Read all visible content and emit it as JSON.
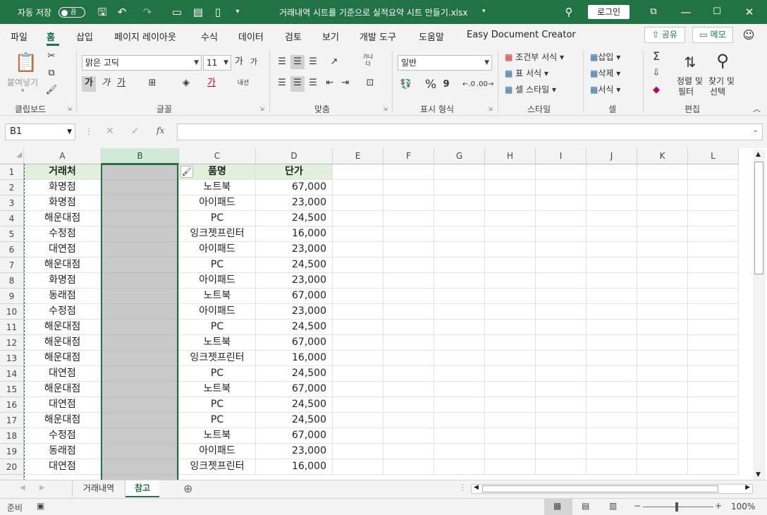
{
  "titlebar": {
    "autosave_label": "자동 저장",
    "toggle_state": "끔",
    "doc_title": "거래내역 시트를 기준으로 실적요약 시트 만들기.xlsx",
    "login_label": "로그인"
  },
  "menu": {
    "tabs": [
      "파일",
      "홈",
      "삽입",
      "페이지 레이아웃",
      "수식",
      "데이터",
      "검토",
      "보기",
      "개발 도구",
      "도움말",
      "Easy Document Creator"
    ],
    "active_tab": "홈",
    "share_label": "공유",
    "memo_label": "메모"
  },
  "ribbon": {
    "paste_label": "붙여넣기",
    "clipboard_label": "클립보드",
    "font_name": "맑은 고딕",
    "font_size": "11",
    "font_grow": "가",
    "font_shrink": "가",
    "bold": "가",
    "italic": "가",
    "underline": "가",
    "font_color_glyph": "가",
    "wrap_glyph": "내선",
    "font_label": "글꼴",
    "orient_glyph": "가나다",
    "align_label": "맞춤",
    "number_format": "일반",
    "percent": "%",
    "comma": "9",
    "number_label": "표시 형식",
    "cond_format": "조건부 서식",
    "table_format": "표 서식",
    "cell_style": "셀 스타일",
    "style_label": "스타일",
    "insert": "삽입",
    "delete": "삭제",
    "format": "서식",
    "cells_label": "셀",
    "sort_filter_1": "정렬 및",
    "sort_filter_2": "필터",
    "find_select_1": "찾기 및",
    "find_select_2": "선택",
    "edit_label": "편집"
  },
  "formula": {
    "name_box": "B1",
    "fx": "fx",
    "value": ""
  },
  "grid": {
    "columns": [
      "A",
      "B",
      "C",
      "D",
      "E",
      "F",
      "G",
      "H",
      "I",
      "J",
      "K",
      "L"
    ],
    "selected_column": "B",
    "header_row": {
      "A": "거래처",
      "B": "",
      "C": "품명",
      "D": "단가"
    },
    "rows": [
      {
        "num": "2",
        "A": "화명점",
        "C": "노트북",
        "D": "67,000"
      },
      {
        "num": "3",
        "A": "화명점",
        "C": "아이패드",
        "D": "23,000"
      },
      {
        "num": "4",
        "A": "해운대점",
        "C": "PC",
        "D": "24,500"
      },
      {
        "num": "5",
        "A": "수정점",
        "C": "잉크젯프린터",
        "D": "16,000"
      },
      {
        "num": "6",
        "A": "대연점",
        "C": "아이패드",
        "D": "23,000"
      },
      {
        "num": "7",
        "A": "해운대점",
        "C": "PC",
        "D": "24,500"
      },
      {
        "num": "8",
        "A": "화명점",
        "C": "아이패드",
        "D": "23,000"
      },
      {
        "num": "9",
        "A": "동래점",
        "C": "노트북",
        "D": "67,000"
      },
      {
        "num": "10",
        "A": "수정점",
        "C": "아이패드",
        "D": "23,000"
      },
      {
        "num": "11",
        "A": "해운대점",
        "C": "PC",
        "D": "24,500"
      },
      {
        "num": "12",
        "A": "해운대점",
        "C": "노트북",
        "D": "67,000"
      },
      {
        "num": "13",
        "A": "해운대점",
        "C": "잉크젯프린터",
        "D": "16,000"
      },
      {
        "num": "14",
        "A": "대연점",
        "C": "PC",
        "D": "24,500"
      },
      {
        "num": "15",
        "A": "해운대점",
        "C": "노트북",
        "D": "67,000"
      },
      {
        "num": "16",
        "A": "대연점",
        "C": "PC",
        "D": "24,500"
      },
      {
        "num": "17",
        "A": "해운대점",
        "C": "PC",
        "D": "24,500"
      },
      {
        "num": "18",
        "A": "수정점",
        "C": "노트북",
        "D": "67,000"
      },
      {
        "num": "19",
        "A": "동래점",
        "C": "아이패드",
        "D": "23,000"
      },
      {
        "num": "20",
        "A": "대연점",
        "C": "잉크젯프린터",
        "D": "16,000"
      }
    ]
  },
  "sheets": {
    "tabs": [
      "거래내역",
      "참고"
    ],
    "active": "참고"
  },
  "status": {
    "ready": "준비",
    "zoom": "100%",
    "zoom_minus": "−",
    "zoom_plus": "+",
    "zoom_level_percent": 100
  },
  "colors": {
    "accent": "#217346",
    "header_fill": "#e2efda",
    "selected_fill": "#c9c9c9"
  },
  "icons": [
    "save-icon",
    "undo-icon",
    "redo-icon",
    "search-icon",
    "restore-icon",
    "minimize-icon",
    "maximize-icon",
    "close-icon",
    "paste-icon",
    "cut-icon",
    "copy-icon",
    "format-painter-icon",
    "sum-icon",
    "sort-icon",
    "find-icon"
  ]
}
